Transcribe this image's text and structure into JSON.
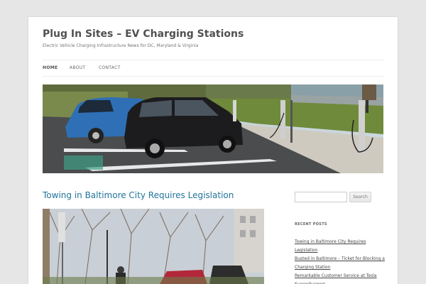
{
  "site": {
    "title": "Plug In Sites – EV Charging Stations",
    "description": "Electric Vehicle Charging Infrastructure News for DC, Maryland & Virginia"
  },
  "nav": {
    "items": [
      {
        "label": "HOME",
        "current": true
      },
      {
        "label": "ABOUT",
        "current": false
      },
      {
        "label": "CONTACT",
        "current": false
      }
    ]
  },
  "header_image": {
    "alt": "header-photo"
  },
  "post": {
    "title": "Towing in Baltimore City Requires Legislation"
  },
  "sidebar": {
    "search": {
      "placeholder": "",
      "button_label": "Search"
    },
    "recent_posts": {
      "heading": "RECENT POSTS",
      "items": [
        "Towing in Baltimore City Requires Legislation",
        "Busted in Baltimore – Ticket for Blocking a Charging Station",
        "Remarkable Customer Service at Tesla Superchargers"
      ]
    }
  },
  "colors": {
    "link": "#21759b",
    "background": "#e6e6e6",
    "page": "#ffffff"
  }
}
